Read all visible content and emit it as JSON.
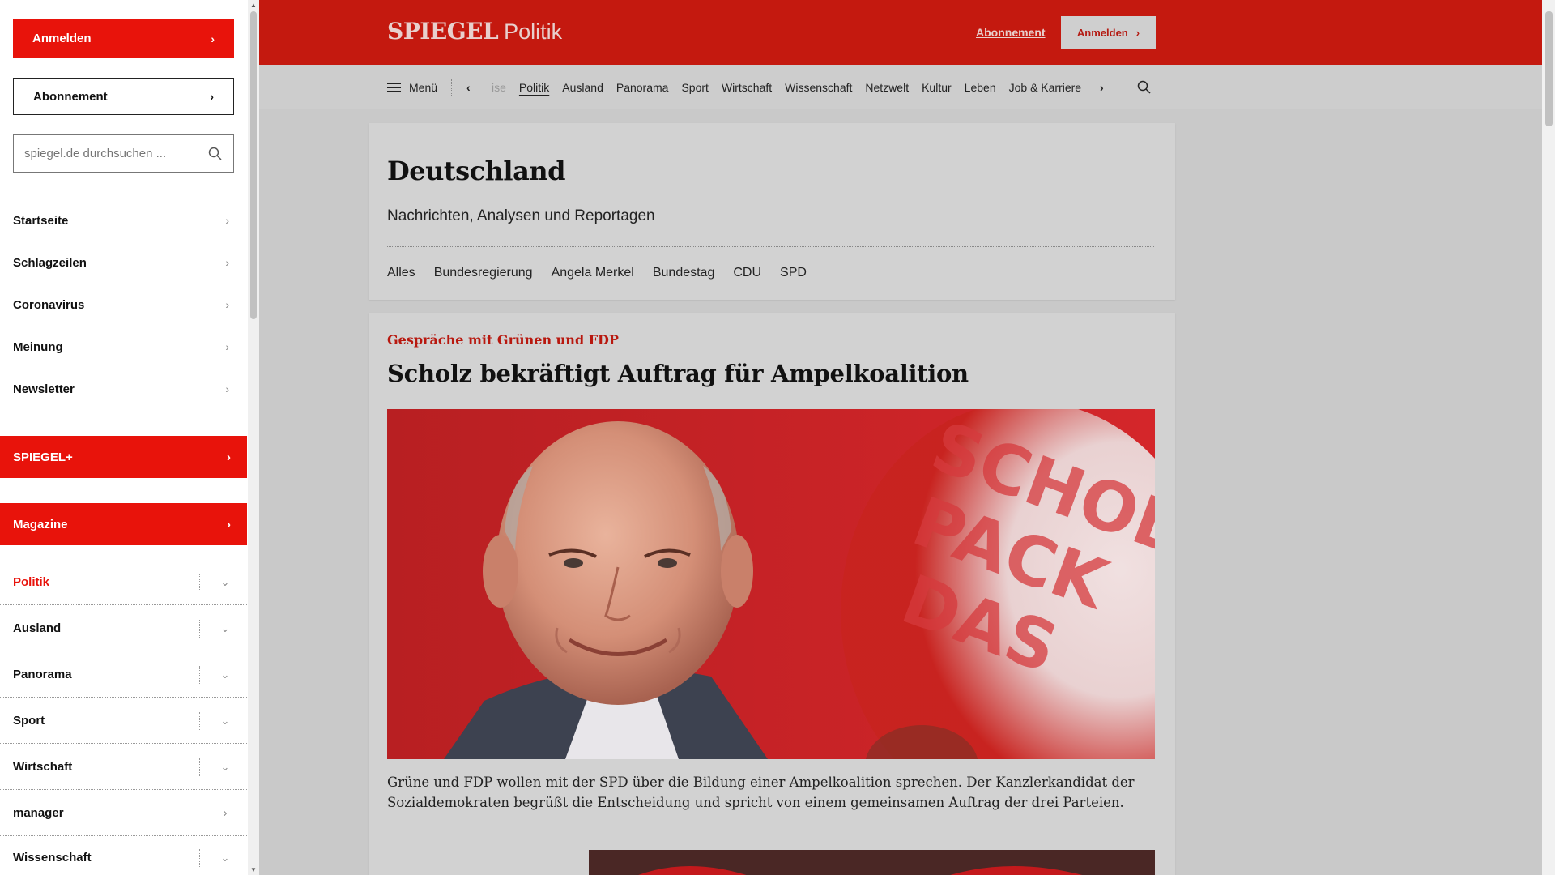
{
  "sidebar": {
    "login_label": "Anmelden",
    "abo_label": "Abonnement",
    "search_placeholder": "spiegel.de durchsuchen ...",
    "links": [
      "Startseite",
      "Schlagzeilen",
      "Coronavirus",
      "Meinung",
      "Newsletter"
    ],
    "spiegel_plus": "SPIEGEL+",
    "magazine": "Magazine",
    "sections": [
      "Politik",
      "Ausland",
      "Panorama",
      "Sport",
      "Wirtschaft",
      "manager",
      "Wissenschaft"
    ],
    "active_section": "Politik"
  },
  "header": {
    "brand": "SPIEGEL",
    "section": "Politik",
    "abo_label": "Abonnement",
    "login_label": "Anmelden"
  },
  "nav": {
    "menu_label": "Menü",
    "items": [
      "ise",
      "Politik",
      "Ausland",
      "Panorama",
      "Sport",
      "Wirtschaft",
      "Wissenschaft",
      "Netzwelt",
      "Kultur",
      "Leben",
      "Job & Karriere"
    ],
    "active_item": "Politik"
  },
  "ressort": {
    "title": "Deutschland",
    "subtitle": "Nachrichten, Analysen und Reportagen",
    "tags": [
      "Alles",
      "Bundesregierung",
      "Angela Merkel",
      "Bundestag",
      "CDU",
      "SPD"
    ]
  },
  "article": {
    "kicker": "Gespräche mit Grünen und FDP",
    "headline": "Scholz bekräftigt Auftrag für Ampelkoalition",
    "teaser": "Grüne und FDP wollen mit der SPD über die Bildung einer Ampelkoalition sprechen. Der Kanzlerkandidat der Sozialdemokraten begrüßt die Entscheidung und spricht von einem gemeinsamen Auftrag der drei Parteien.",
    "poster_text": [
      "SCHOL",
      "PACK",
      "DAS"
    ]
  },
  "colors": {
    "brand_red": "#c4190f",
    "button_red": "#e8130b",
    "kicker_red": "#b8180f"
  }
}
